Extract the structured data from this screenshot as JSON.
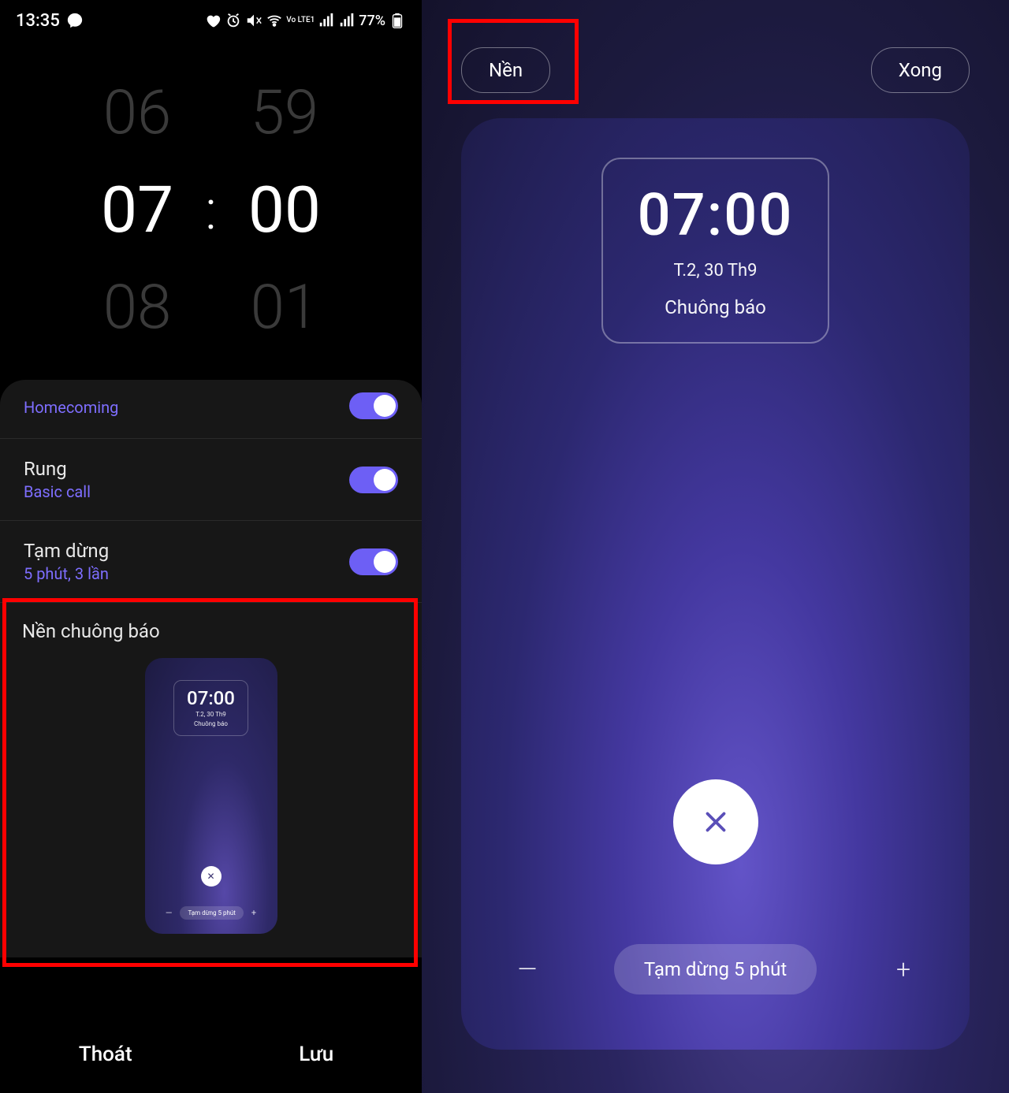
{
  "status_bar": {
    "time": "13:35",
    "battery": "77%",
    "lte_label": "Vo LTE1"
  },
  "time_picker": {
    "hour_prev": "06",
    "hour_sel": "07",
    "hour_next": "08",
    "min_prev": "59",
    "min_sel": "00",
    "min_next": "01",
    "colon": ":"
  },
  "settings": {
    "sound_sub": "Homecoming",
    "vibration": {
      "title": "Rung",
      "sub": "Basic call"
    },
    "snooze": {
      "title": "Tạm dừng",
      "sub": "5 phút, 3 lần"
    }
  },
  "alarm_bg": {
    "section_title": "Nền chuông báo",
    "thumb_time": "07:00",
    "thumb_date": "T.2, 30 Th9",
    "thumb_label": "Chuông báo",
    "thumb_snooze": "Tạm dừng 5 phút"
  },
  "bottom": {
    "cancel": "Thoát",
    "save": "Lưu"
  },
  "right": {
    "bg_button": "Nền",
    "done_button": "Xong",
    "time": "07:00",
    "date": "T.2, 30 Th9",
    "label": "Chuông báo",
    "snooze": "Tạm dừng 5 phút",
    "minus": "—",
    "plus": "+"
  }
}
